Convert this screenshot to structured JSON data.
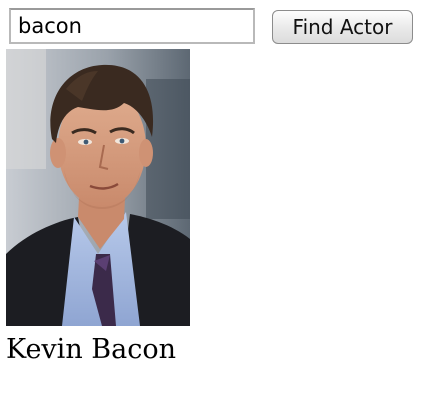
{
  "search": {
    "value": "bacon"
  },
  "find_button": {
    "label": "Find Actor"
  },
  "result": {
    "actor_name": "Kevin Bacon",
    "photo_icon": "portrait-photo"
  }
}
